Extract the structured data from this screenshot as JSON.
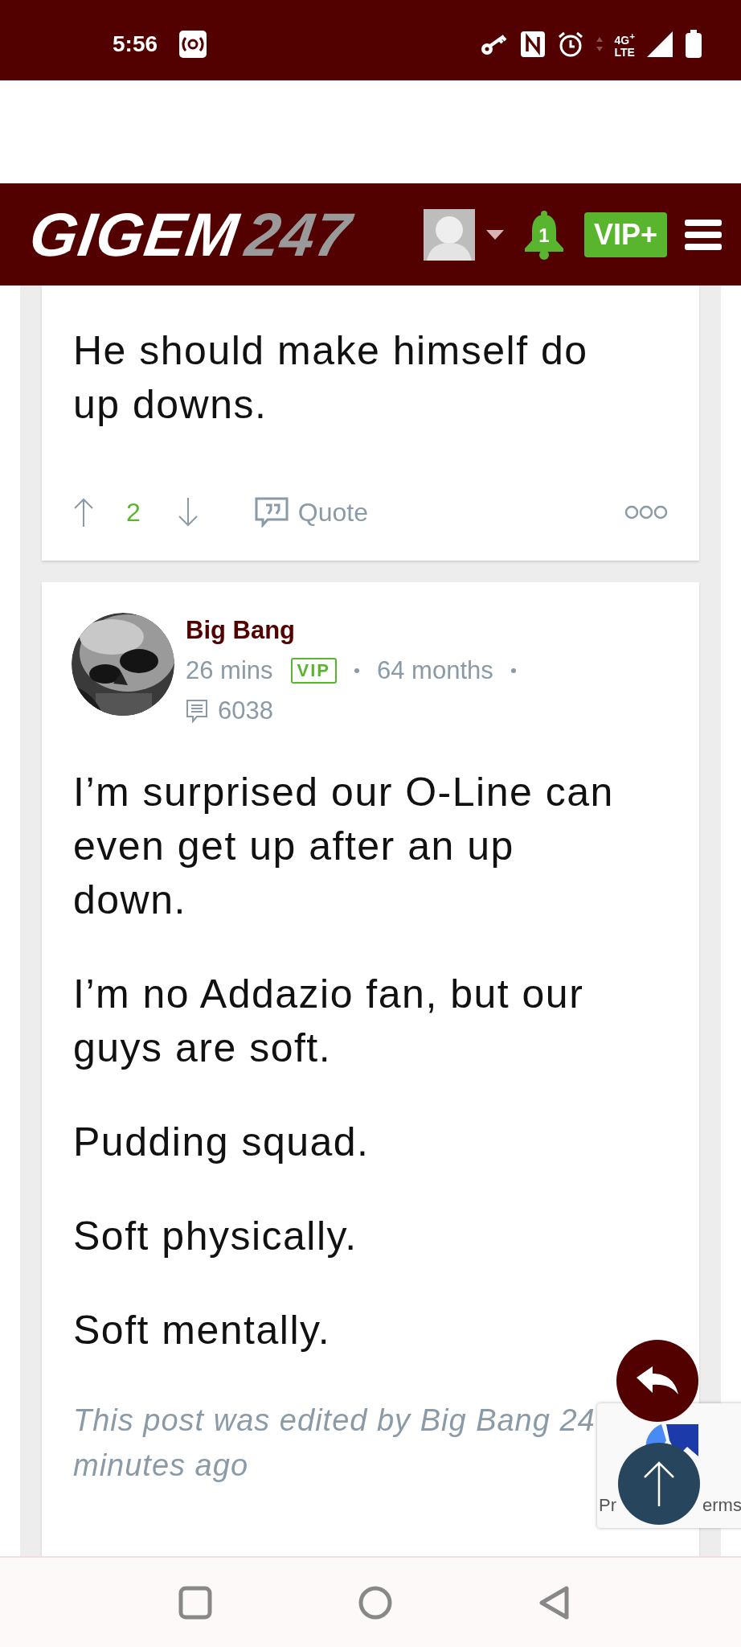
{
  "status_bar": {
    "time": "5:56",
    "network_top": "4G$^{+}$",
    "network_bottom": "LTE"
  },
  "header": {
    "logo_main": "GIGEM",
    "logo_accent": "247",
    "notifications": "1",
    "vip_button": "VIP+"
  },
  "posts": [
    {
      "kind": "continued",
      "paragraphs": [
        "He should make himself do up downs."
      ],
      "votes": "2",
      "quote": "Quote"
    },
    {
      "kind": "full",
      "author": "Big Bang",
      "time": "26 mins",
      "badge": "VIP",
      "tenure": "64 months",
      "post_count": "6038",
      "paragraphs": [
        "I’m surprised our O-Line can even get up after an up down.",
        "I’m no Addazio fan, but our guys are soft.",
        "Pudding squad.",
        "Soft physically.",
        "Soft mentally."
      ],
      "edited_note": "This post was edited by Big Bang 24 minutes ago"
    }
  ],
  "recaptcha": {
    "texts": [
      "Pr",
      "erms"
    ]
  }
}
